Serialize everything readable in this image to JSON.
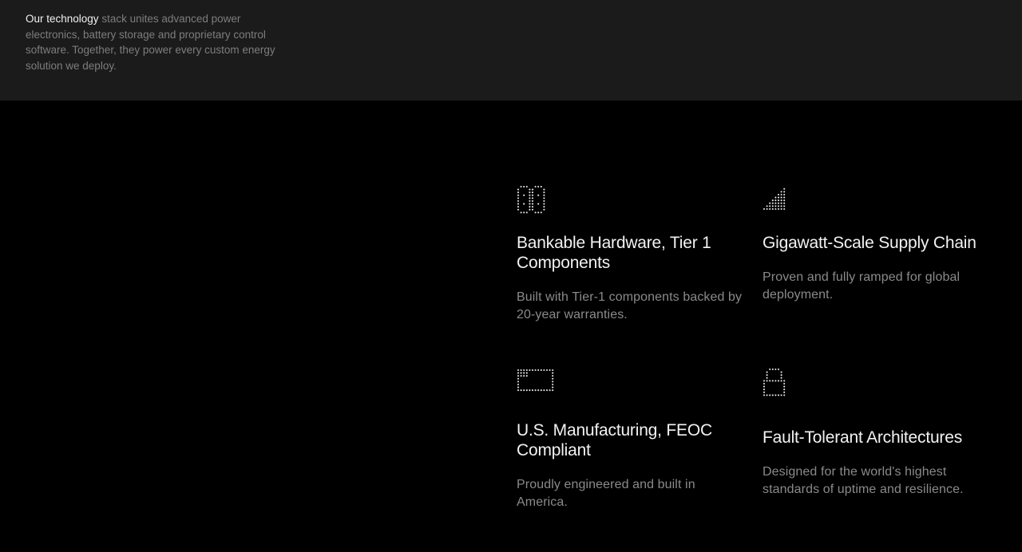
{
  "intro": {
    "lead": "Our technology",
    "rest": " stack unites advanced power electronics, battery storage and proprietary control software. Together, they power every custom energy solution we deploy."
  },
  "features": [
    {
      "icon": "battery-modules-icon",
      "title": "Bankable Hardware, Tier 1 Components",
      "description": "Built with Tier-1 components backed by 20-year warranties."
    },
    {
      "icon": "signal-bars-icon",
      "title": "Gigawatt-Scale Supply Chain",
      "description": "Proven and fully ramped for global deployment."
    },
    {
      "icon": "flag-icon",
      "title": "U.S. Manufacturing, FEOC Compliant",
      "description": "Proudly engineered and built in America."
    },
    {
      "icon": "lock-icon",
      "title": "Fault-Tolerant Architectures",
      "description": "Designed for the world's highest standards of uptime and resilience."
    }
  ],
  "colors": {
    "band": "#1b1b1b",
    "background": "#000000",
    "heading": "#f2f2f2",
    "muted": "#8a8a8a"
  }
}
